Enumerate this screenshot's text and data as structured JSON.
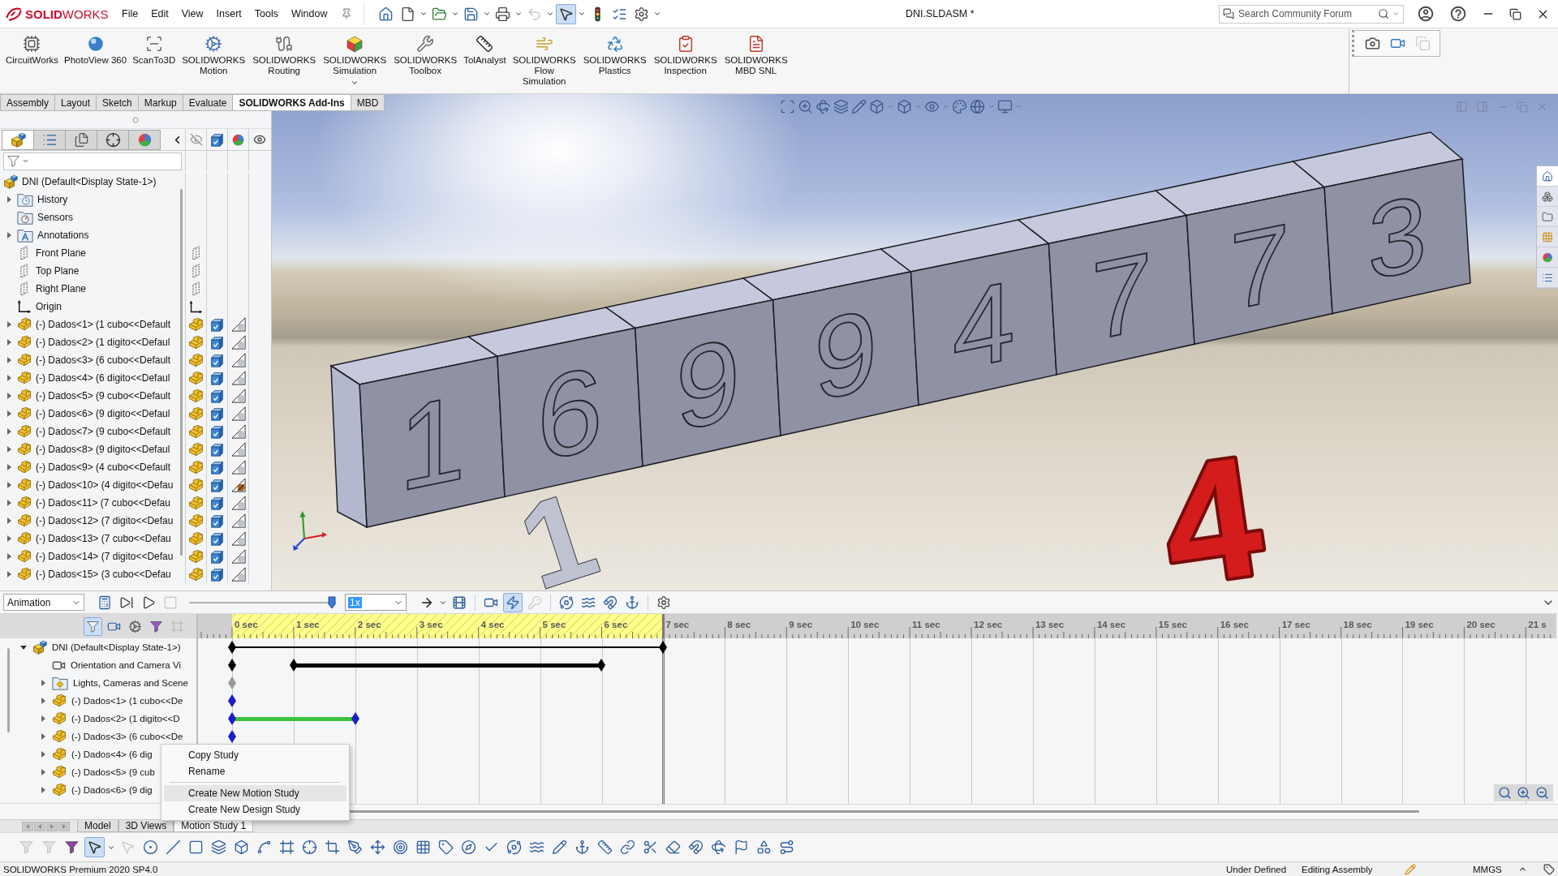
{
  "title_bar": {
    "logo": "**SOLID**WORKS",
    "menu": [
      "File",
      "Edit",
      "View",
      "Insert",
      "Tools",
      "Window"
    ],
    "quick_access": [
      {
        "pressed": false,
        "disabled": false
      },
      {
        "pressed": false,
        "disabled": false
      },
      {
        "pressed": false,
        "disabled": false
      },
      {
        "pressed": false,
        "disabled": false
      },
      {
        "pressed": false,
        "disabled": false
      },
      {
        "pressed": false,
        "disabled": true
      },
      {
        "pressed": true,
        "disabled": false
      },
      {
        "pressed": false,
        "disabled": false
      },
      {
        "pressed": false,
        "disabled": false
      },
      {
        "pressed": false,
        "disabled": false
      }
    ],
    "document_title": "DNI.SLDASM *",
    "search": {
      "placeholder": "Search Community Forum"
    }
  },
  "ribbon": {
    "commands": [
      {
        "label": "CircuitWorks",
        "dropdown": false
      },
      {
        "label": "PhotoView 360",
        "dropdown": false
      },
      {
        "label": "ScanTo3D",
        "dropdown": false
      },
      {
        "label": "SOLIDWORKS Motion",
        "dropdown": false
      },
      {
        "label": "SOLIDWORKS Routing",
        "dropdown": false
      },
      {
        "label": "SOLIDWORKS Simulation",
        "dropdown": true
      },
      {
        "label": "SOLIDWORKS Toolbox",
        "dropdown": false
      },
      {
        "label": "TolAnalyst",
        "dropdown": false
      },
      {
        "label": "SOLIDWORKS Flow Simulation",
        "dropdown": false
      },
      {
        "label": "SOLIDWORKS Plastics",
        "dropdown": false
      },
      {
        "label": "SOLIDWORKS Inspection",
        "dropdown": false
      },
      {
        "label": "SOLIDWORKS MBD SNL",
        "dropdown": false
      }
    ],
    "capture_tools": [
      {
        "disabled": false
      },
      {
        "disabled": false
      },
      {
        "disabled": true
      }
    ]
  },
  "command_tabs": [
    {
      "label": "Assembly",
      "selected": false
    },
    {
      "label": "Layout",
      "selected": false
    },
    {
      "label": "Sketch",
      "selected": false
    },
    {
      "label": "Markup",
      "selected": false
    },
    {
      "label": "Evaluate",
      "selected": false
    },
    {
      "label": "SOLIDWORKS Add-Ins",
      "selected": true
    },
    {
      "label": "MBD",
      "selected": false
    }
  ],
  "feature_manager": {
    "tabs": [
      {
        "selected": true
      },
      {
        "selected": false
      },
      {
        "selected": false
      },
      {
        "selected": false
      },
      {
        "selected": false
      }
    ],
    "tree": {
      "label": "DNI (Default<Display State-1>)",
      "kind": "assembly",
      "children": [
        {
          "label": "History",
          "kind": "history",
          "expanded": false
        },
        {
          "label": "Sensors",
          "kind": "sensors"
        },
        {
          "label": "Annotations",
          "kind": "annotations",
          "expanded": false
        },
        {
          "label": "Front Plane",
          "kind": "plane"
        },
        {
          "label": "Top Plane",
          "kind": "plane"
        },
        {
          "label": "Right Plane",
          "kind": "plane"
        },
        {
          "label": "Origin",
          "kind": "origin"
        },
        {
          "label": "(-) Dados<1> (1 cubo<<Default",
          "kind": "component",
          "expanded": false,
          "custom_appearance": false
        },
        {
          "label": "(-) Dados<2> (1 digito<<Defaul",
          "kind": "component",
          "expanded": false,
          "custom_appearance": false
        },
        {
          "label": "(-) Dados<3> (6 cubo<<Default",
          "kind": "component",
          "expanded": false,
          "custom_appearance": false
        },
        {
          "label": "(-) Dados<4> (6 digito<<Defaul",
          "kind": "component",
          "expanded": false,
          "custom_appearance": false
        },
        {
          "label": "(-) Dados<5> (9 cubo<<Default",
          "kind": "component",
          "expanded": false,
          "custom_appearance": false
        },
        {
          "label": "(-) Dados<6> (9 digito<<Defaul",
          "kind": "component",
          "expanded": false,
          "custom_appearance": false
        },
        {
          "label": "(-) Dados<7> (9 cubo<<Default",
          "kind": "component",
          "expanded": false,
          "custom_appearance": false
        },
        {
          "label": "(-) Dados<8> (9 digito<<Defaul",
          "kind": "component",
          "expanded": false,
          "custom_appearance": false
        },
        {
          "label": "(-) Dados<9> (4 cubo<<Default",
          "kind": "component",
          "expanded": false,
          "custom_appearance": false
        },
        {
          "label": "(-) Dados<10> (4 digito<<Defau",
          "kind": "component",
          "expanded": false,
          "custom_appearance": true
        },
        {
          "label": "(-) Dados<11> (7 cubo<<Defau",
          "kind": "component",
          "expanded": false,
          "custom_appearance": false
        },
        {
          "label": "(-) Dados<12> (7 digito<<Defau",
          "kind": "component",
          "expanded": false,
          "custom_appearance": false
        },
        {
          "label": "(-) Dados<13> (7 cubo<<Defau",
          "kind": "component",
          "expanded": false,
          "custom_appearance": false
        },
        {
          "label": "(-) Dados<14> (7 digito<<Defau",
          "kind": "component",
          "expanded": false,
          "custom_appearance": false
        },
        {
          "label": "(-) Dados<15> (3 cubo<<Defau",
          "kind": "component",
          "expanded": false,
          "custom_appearance": false
        }
      ]
    }
  },
  "viewport": {
    "model": {
      "digits": [
        "1",
        "6",
        "9",
        "9",
        "4",
        "7",
        "7",
        "3"
      ],
      "loose_parts": [
        {
          "text": "4",
          "color": "#d41c1c"
        },
        {
          "text": "1",
          "color": "#bfc2d0"
        }
      ]
    },
    "task_pane": [
      {
        "selected": true
      },
      {
        "selected": false
      },
      {
        "selected": false
      },
      {
        "selected": false
      },
      {
        "selected": false
      },
      {
        "selected": false
      }
    ]
  },
  "motion_manager": {
    "study_type": "Animation",
    "tools": [
      {
        "pressed": false,
        "disabled": false
      },
      {
        "pressed": false,
        "disabled": false
      },
      {
        "pressed": false,
        "disabled": false
      },
      {
        "pressed": false,
        "disabled": true
      },
      {
        "pressed": false,
        "disabled": false
      },
      {
        "pressed": false,
        "disabled": false
      },
      {
        "pressed": false,
        "disabled": false
      },
      {
        "pressed": true,
        "disabled": false
      },
      {
        "pressed": false,
        "disabled": true
      },
      {
        "pressed": false,
        "disabled": false
      },
      {
        "pressed": false,
        "disabled": false
      },
      {
        "pressed": false,
        "disabled": false
      },
      {
        "pressed": false,
        "disabled": false
      },
      {
        "pressed": false,
        "disabled": false
      }
    ],
    "slider": {
      "level": 1
    },
    "speed": {
      "value": "1x",
      "highlighted": true
    },
    "filters": [
      {
        "pressed": true,
        "disabled": false
      },
      {
        "pressed": false,
        "disabled": false
      },
      {
        "pressed": false,
        "disabled": false
      },
      {
        "pressed": false,
        "disabled": false
      },
      {
        "pressed": false,
        "disabled": true
      }
    ],
    "tree": {
      "label": "DNI (Default<Display State-1>)",
      "kind": "assembly",
      "expanded": true,
      "children": [
        {
          "label": "Orientation and Camera Vi",
          "kind": "camera"
        },
        {
          "label": "Lights, Cameras and Scene",
          "kind": "lights",
          "expanded": false
        },
        {
          "label": "(-) Dados<1> (1 cubo<<De",
          "kind": "component",
          "expanded": false
        },
        {
          "label": "(-) Dados<2> (1 digito<<D",
          "kind": "component",
          "expanded": false
        },
        {
          "label": "(-) Dados<3> (6 cubo<<De",
          "kind": "component",
          "expanded": false
        },
        {
          "label": "(-) Dados<4> (6 dig",
          "kind": "component",
          "expanded": false
        },
        {
          "label": "(-) Dados<5> (9 cub",
          "kind": "component",
          "expanded": false
        },
        {
          "label": "(-) Dados<6> (9 dig",
          "kind": "component",
          "expanded": false
        }
      ]
    },
    "timeline": {
      "ticks": [
        "0 sec",
        "1 sec",
        "2 sec",
        "3 sec",
        "4 sec",
        "5 sec",
        "6 sec",
        "7 sec",
        "8 sec",
        "9 sec",
        "10 sec",
        "11 sec",
        "12 sec",
        "13 sec",
        "14 sec",
        "15 sec",
        "16 sec",
        "17 sec",
        "18 sec",
        "19 sec",
        "20 sec",
        "21 s"
      ],
      "rows": [
        {
          "color": "#000000",
          "keys": [
            {
              "level": 0,
              "link": {
                "kind": "thin",
                "color": "#000000"
              }
            },
            {
              "level": 0.3256
            }
          ]
        },
        {
          "color": "#000000",
          "keys": [
            {
              "level": 0
            },
            {
              "level": 0.0465,
              "link": {
                "kind": "thick",
                "color": "#000000"
              }
            },
            {
              "level": 0.2791
            }
          ]
        },
        {
          "color": "#9a9a9a",
          "keys": [
            {
              "level": 0
            }
          ]
        },
        {
          "color": "#1c1cc8",
          "keys": [
            {
              "level": 0
            }
          ]
        },
        {
          "color": "#1c1cc8",
          "keys": [
            {
              "level": 0,
              "link": {
                "kind": "thick",
                "color": "#3cc23c"
              }
            },
            {
              "level": 0.093
            }
          ]
        },
        {
          "color": "#1c1cc8",
          "keys": [
            {
              "level": 0
            }
          ]
        }
      ]
    },
    "context_menu": {
      "groups": [
        [
          {
            "label": "Copy Study",
            "selected": false
          },
          {
            "label": "Rename",
            "selected": false
          }
        ],
        [
          {
            "label": "Create New Motion Study",
            "selected": true
          },
          {
            "label": "Create New Design Study",
            "selected": false
          }
        ]
      ]
    },
    "tabs": [
      {
        "label": "Model",
        "selected": false
      },
      {
        "label": "3D Views",
        "selected": false
      },
      {
        "label": "Motion Study 1",
        "selected": true
      }
    ]
  },
  "sketch_toolbar": [
    {
      "pressed": false,
      "disabled": true
    },
    {
      "pressed": false,
      "disabled": true
    },
    {
      "pressed": false,
      "disabled": false
    },
    {
      "pressed": true,
      "disabled": false
    },
    {
      "pressed": false,
      "disabled": true
    },
    {
      "pressed": false,
      "disabled": false
    },
    {
      "pressed": false,
      "disabled": false
    },
    {
      "pressed": false,
      "disabled": false
    },
    {
      "pressed": false,
      "disabled": false
    },
    {
      "pressed": false,
      "disabled": false
    },
    {
      "pressed": false,
      "disabled": false
    },
    {
      "pressed": false,
      "disabled": false
    },
    {
      "pressed": false,
      "disabled": false
    },
    {
      "pressed": false,
      "disabled": false
    },
    {
      "pressed": false,
      "disabled": false
    },
    {
      "pressed": false,
      "disabled": false
    },
    {
      "pressed": false,
      "disabled": false
    },
    {
      "pressed": false,
      "disabled": false
    },
    {
      "pressed": false,
      "disabled": false
    },
    {
      "pressed": false,
      "disabled": false
    },
    {
      "pressed": false,
      "disabled": false
    },
    {
      "pressed": false,
      "disabled": false
    },
    {
      "pressed": false,
      "disabled": false
    },
    {
      "pressed": false,
      "disabled": false
    },
    {
      "pressed": false,
      "disabled": false
    },
    {
      "pressed": false,
      "disabled": false
    },
    {
      "pressed": false,
      "disabled": false
    },
    {
      "pressed": false,
      "disabled": false
    },
    {
      "pressed": false,
      "disabled": false
    },
    {
      "pressed": false,
      "disabled": false
    },
    {
      "pressed": false,
      "disabled": false
    },
    {
      "pressed": false,
      "disabled": false
    },
    {
      "pressed": false,
      "disabled": false
    },
    {
      "pressed": false,
      "disabled": false
    }
  ],
  "status_bar": {
    "product": "SOLIDWORKS Premium 2020 SP4.0",
    "state": "Under Defined",
    "mode": "Editing Assembly",
    "units": "MMGS"
  }
}
